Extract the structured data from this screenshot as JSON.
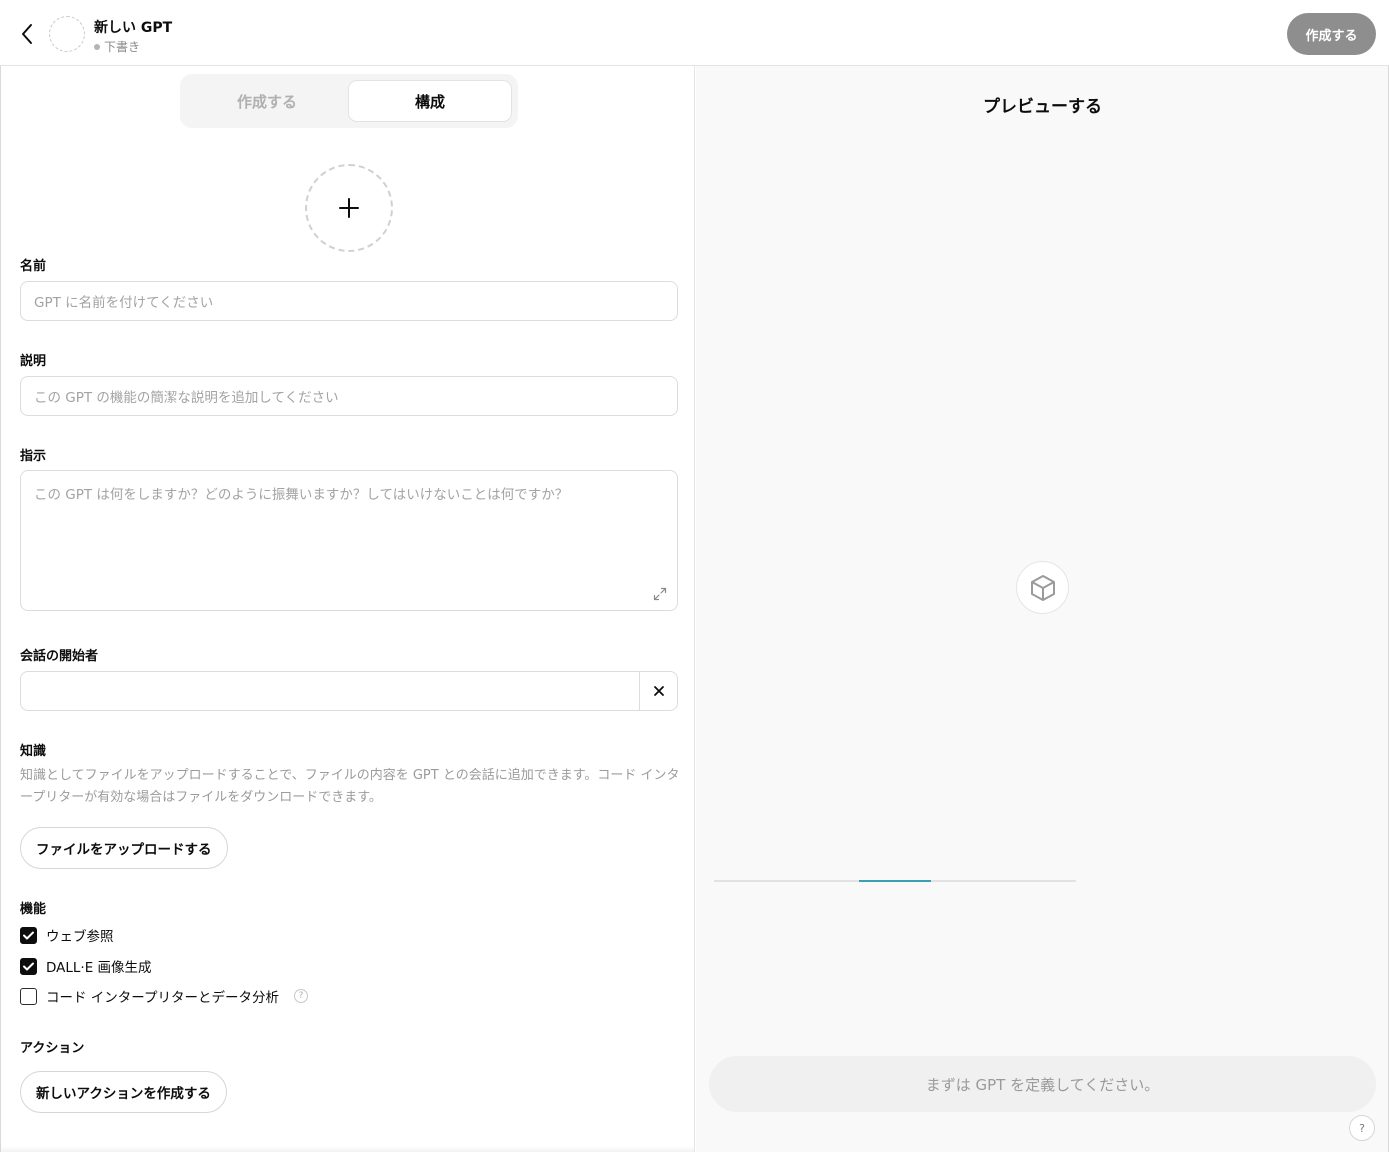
{
  "header": {
    "title": "新しい GPT",
    "status": "下書き",
    "create_label": "作成する"
  },
  "tabs": [
    {
      "label": "作成する",
      "active": false
    },
    {
      "label": "構成",
      "active": true
    }
  ],
  "form": {
    "name": {
      "label": "名前",
      "placeholder": "GPT に名前を付けてください",
      "value": ""
    },
    "description": {
      "label": "説明",
      "placeholder": "この GPT の機能の簡潔な説明を追加してください",
      "value": ""
    },
    "instructions": {
      "label": "指示",
      "placeholder": "この GPT は何をしますか？どのように振舞いますか？してはいけないことは何ですか？",
      "value": ""
    },
    "starters": {
      "label": "会話の開始者",
      "value": ""
    },
    "knowledge": {
      "label": "知識",
      "description": "知識としてファイルをアップロードすることで、ファイルの内容を GPT との会話に追加できます。コード インタープリターが有効な場合はファイルをダウンロードできます。",
      "upload_label": "ファイルをアップロードする"
    },
    "capabilities": {
      "label": "機能",
      "items": [
        {
          "label": "ウェブ参照",
          "checked": true
        },
        {
          "label": "DALL·E 画像生成",
          "checked": true
        },
        {
          "label": "コード インタープリターとデータ分析",
          "checked": false
        }
      ]
    },
    "actions": {
      "label": "アクション",
      "create_label": "新しいアクションを作成する"
    }
  },
  "preview": {
    "title": "プレビューする",
    "progress": 0.2,
    "progress_start": 0.4,
    "prompt_placeholder": "まずは GPT を定義してください。",
    "help_label": "?"
  },
  "colors": {
    "accent_progress": "#3aa0b2",
    "create_button_bg": "#8e8e8e"
  }
}
